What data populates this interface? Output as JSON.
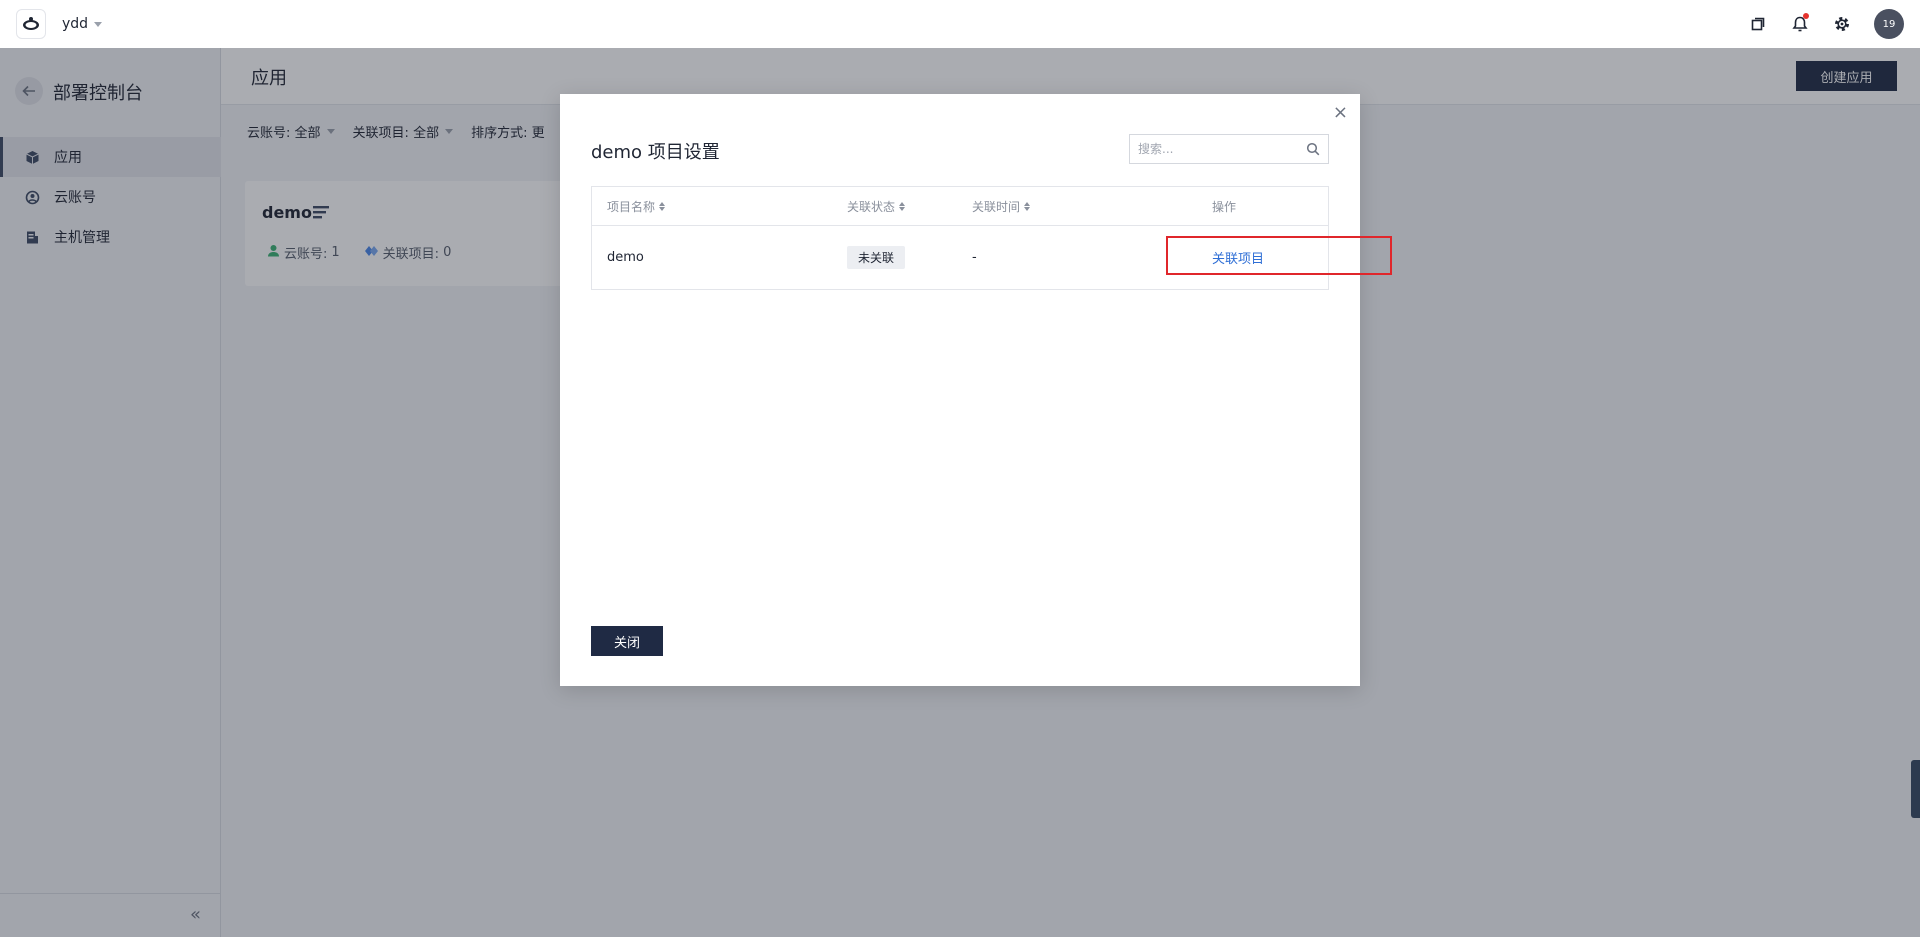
{
  "topbar": {
    "workspace_name": "ydd",
    "avatar_text": "19",
    "icons": [
      "logo-icon",
      "copy-window-icon",
      "bell-icon",
      "gear-icon"
    ],
    "notification_dot_color": "#e5322d"
  },
  "sidebar": {
    "title": "部署控制台",
    "items": [
      {
        "label": "应用",
        "icon": "cube-icon",
        "active": true
      },
      {
        "label": "云账号",
        "icon": "cloud-account-icon",
        "active": false
      },
      {
        "label": "主机管理",
        "icon": "server-icon",
        "active": false
      }
    ],
    "collapse_glyph": "«"
  },
  "main": {
    "title": "应用",
    "create_button": "创建应用",
    "filters": [
      {
        "label": "云账号:",
        "value": "全部"
      },
      {
        "label": "关联项目:",
        "value": "全部"
      },
      {
        "label": "排序方式:",
        "value": "更"
      }
    ],
    "card": {
      "title": "demo",
      "cloud_accounts_label": "云账号:",
      "cloud_accounts_value": "1",
      "linked_projects_label": "关联项目:",
      "linked_projects_value": "0"
    }
  },
  "modal": {
    "title": "demo 项目设置",
    "search_placeholder": "搜索...",
    "columns": [
      "项目名称",
      "关联状态",
      "关联时间",
      "操作"
    ],
    "rows": [
      {
        "name": "demo",
        "status": "未关联",
        "time": "-",
        "action": "关联项目"
      }
    ],
    "close_button": "关闭"
  },
  "colors": {
    "primary_dark": "#1f2a44",
    "link": "#2f6fd6",
    "highlight": "#e0262b"
  }
}
